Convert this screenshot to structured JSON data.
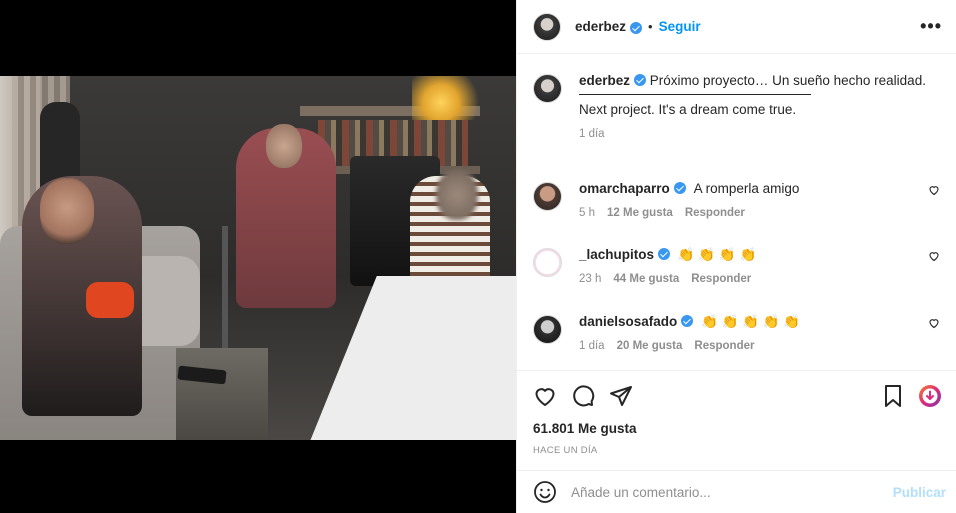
{
  "post": {
    "author": "ederbez",
    "follow_label": "Seguir",
    "dot": "•",
    "more_label": "•••",
    "caption_line1": "Próximo proyecto… Un sueño hecho realidad.",
    "caption_line2": "Next project. It's a dream come true.",
    "caption_time": "1 día"
  },
  "comments": [
    {
      "user": "omarchaparro",
      "text": "A romperla amigo",
      "time": "5 h",
      "likes": "12 Me gusta",
      "reply": "Responder"
    },
    {
      "user": "_lachupitos",
      "text": "👏 👏 👏 👏",
      "time": "23 h",
      "likes": "44 Me gusta",
      "reply": "Responder"
    },
    {
      "user": "danielsosafado",
      "text": "👏 👏 👏 👏 👏",
      "time": "1 día",
      "likes": "20 Me gusta",
      "reply": "Responder"
    }
  ],
  "stats": {
    "likes": "61.801 Me gusta",
    "date": "HACE UN DÍA"
  },
  "composer": {
    "placeholder": "Añade un comentario...",
    "publish_label": "Publicar"
  },
  "colors": {
    "accent": "#0095f6",
    "verified": "#3897f0",
    "muted": "#8e8e8e"
  }
}
